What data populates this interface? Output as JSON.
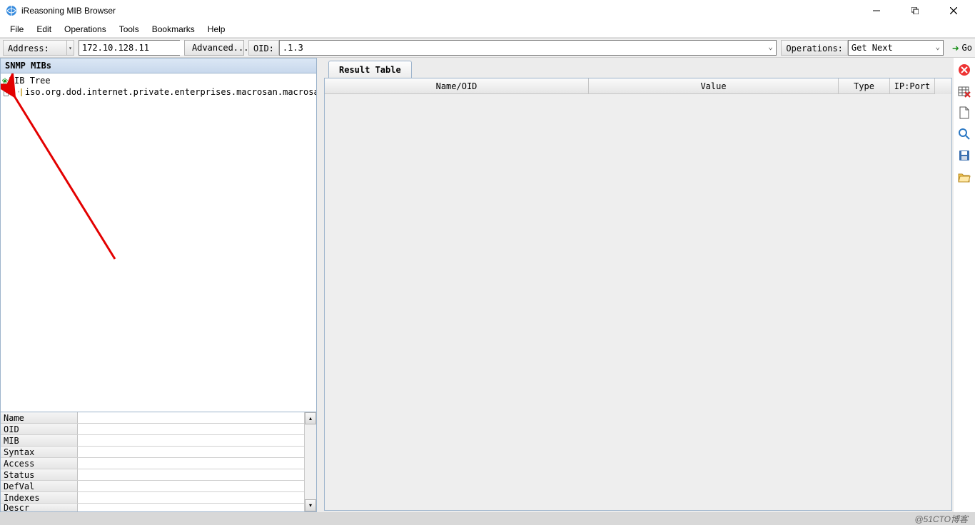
{
  "window": {
    "title": "iReasoning MIB Browser"
  },
  "menu": {
    "items": [
      "File",
      "Edit",
      "Operations",
      "Tools",
      "Bookmarks",
      "Help"
    ]
  },
  "toolbar": {
    "address_label": "Address:",
    "address_value": "172.10.128.11",
    "advanced_label": "Advanced...",
    "oid_label": "OID:",
    "oid_value": ".1.3",
    "operations_label": "Operations:",
    "operations_value": "Get Next",
    "go_label": "Go"
  },
  "sidebar": {
    "header": "SNMP MIBs",
    "tree_root": "MIB Tree",
    "tree_child": "iso.org.dod.internet.private.enterprises.macrosan.macrosanStorage"
  },
  "properties": {
    "rows": [
      "Name",
      "OID",
      "MIB",
      "Syntax",
      "Access",
      "Status",
      "DefVal",
      "Indexes",
      "Descr"
    ]
  },
  "result": {
    "tab_label": "Result Table",
    "columns": [
      "Name/OID",
      "Value",
      "Type",
      "IP:Port"
    ]
  },
  "footer": {
    "watermark": "@51CTO博客"
  }
}
